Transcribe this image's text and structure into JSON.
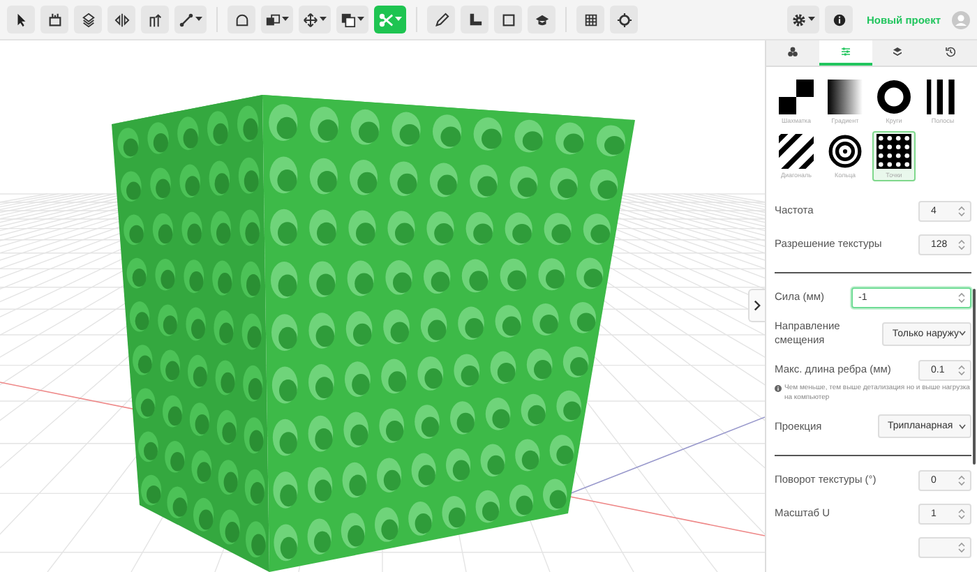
{
  "toolbar": {
    "groups": [
      {
        "tools": [
          {
            "selected": false,
            "dropdown": false
          },
          {
            "selected": false,
            "dropdown": false
          },
          {
            "selected": false,
            "dropdown": false
          },
          {
            "selected": false,
            "dropdown": false
          },
          {
            "selected": false,
            "dropdown": false
          },
          {
            "selected": false,
            "dropdown": true
          }
        ]
      },
      {
        "tools": [
          {
            "selected": false,
            "dropdown": false
          },
          {
            "selected": false,
            "dropdown": true
          },
          {
            "selected": false,
            "dropdown": true
          },
          {
            "selected": false,
            "dropdown": true
          },
          {
            "selected": true,
            "dropdown": true
          }
        ]
      },
      {
        "tools": [
          {
            "selected": false,
            "dropdown": false
          },
          {
            "selected": false,
            "dropdown": false
          },
          {
            "selected": false,
            "dropdown": false
          },
          {
            "selected": false,
            "dropdown": false
          }
        ]
      },
      {
        "tools": [
          {
            "selected": false,
            "dropdown": false
          },
          {
            "selected": false,
            "dropdown": false
          }
        ]
      }
    ],
    "project_name": "Новый проект"
  },
  "panel": {
    "tabs": [
      {
        "selected": false
      },
      {
        "selected": true
      },
      {
        "selected": false
      },
      {
        "selected": false
      }
    ],
    "textures": [
      {
        "label": "Шахматка",
        "selected": false
      },
      {
        "label": "Градиент",
        "selected": false
      },
      {
        "label": "Круги",
        "selected": false
      },
      {
        "label": "Полосы",
        "selected": false
      },
      {
        "label": "Диагональ",
        "selected": false
      },
      {
        "label": "Кольца",
        "selected": false
      },
      {
        "label": "Точки",
        "selected": true
      }
    ],
    "sections": [
      {
        "fields": [
          {
            "kind": "number",
            "label": "Частота",
            "value": "4",
            "focused": false
          },
          {
            "kind": "number",
            "label": "Разрешение текстуры",
            "value": "128",
            "focused": false
          }
        ]
      },
      {
        "fields": [
          {
            "kind": "number",
            "label": "Сила (мм)",
            "value": "-1",
            "focused": true
          },
          {
            "kind": "select",
            "label": "Направление смещения",
            "value": "Только наружу"
          },
          {
            "kind": "number",
            "label": "Макс. длина ребра (мм)",
            "value": "0.1",
            "focused": false,
            "note": "Чем меньше, тем выше детализация но и выше нагрузка на компьютер"
          },
          {
            "kind": "select",
            "label": "Проекция",
            "value": "Трипланарная"
          }
        ]
      },
      {
        "fields": [
          {
            "kind": "number",
            "label": "Поворот текстуры (°)",
            "value": "0",
            "focused": false
          },
          {
            "kind": "number",
            "label": "Масштаб U",
            "value": "1",
            "focused": false
          },
          {
            "kind": "number",
            "focused": false
          }
        ]
      }
    ]
  }
}
